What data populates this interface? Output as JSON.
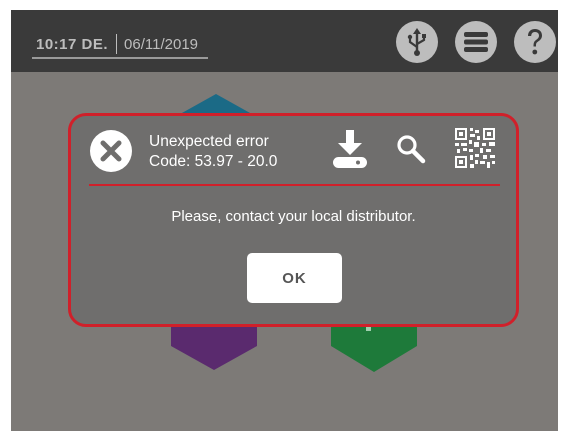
{
  "status_bar": {
    "time": "10:17 DE.",
    "date": "06/11/2019",
    "icons": [
      "usb-icon",
      "menu-icon",
      "help-icon"
    ]
  },
  "background_tiles": {
    "colors": [
      "#1b6a86",
      "#5a2a6e",
      "#1e7a3a"
    ],
    "icons": [
      "document-icon",
      "gear-icon"
    ]
  },
  "dialog": {
    "title": "Unexpected error",
    "code": "Code: 53.97 - 20.0",
    "message": "Please, contact your local distributor.",
    "ok_label": "OK",
    "icons": [
      "error-icon",
      "download-icon",
      "search-icon",
      "qr-code-icon"
    ],
    "accent_color": "#d0202a"
  }
}
